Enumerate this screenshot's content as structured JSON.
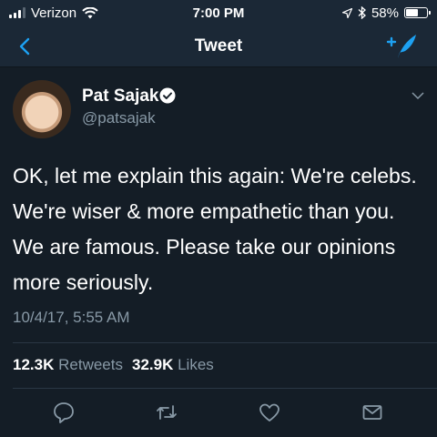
{
  "status_bar": {
    "carrier": "Verizon",
    "time": "7:00 PM",
    "battery_percent": "58%",
    "battery_level": 0.58,
    "icons": [
      "signal-icon",
      "wifi-icon",
      "location-icon",
      "bluetooth-icon",
      "battery-icon"
    ]
  },
  "nav": {
    "title": "Tweet",
    "back_icon": "chevron-left-icon",
    "compose_icon": "compose-tweet-icon"
  },
  "tweet": {
    "author_name": "Pat Sajak",
    "handle": "@patsajak",
    "verified": true,
    "text": "OK, let me explain this again: We're celebs. We're wiser & more empathetic than you. We are famous. Please take our opinions more seriously.",
    "timestamp": "10/4/17, 5:55 AM",
    "retweets_count": "12.3K",
    "retweets_label": "Retweets",
    "likes_count": "32.9K",
    "likes_label": "Likes"
  },
  "actions": [
    "reply-icon",
    "retweet-icon",
    "like-icon",
    "share-icon"
  ],
  "colors": {
    "background": "#141d26",
    "bar": "#1b2836",
    "accent": "#1da1f2",
    "secondary_text": "#8899a6"
  }
}
